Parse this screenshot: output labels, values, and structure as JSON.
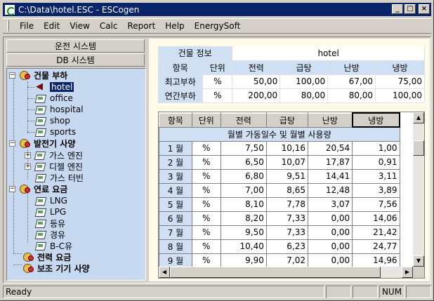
{
  "window": {
    "title": "C:\\Data\\hotel.ESC - ESCogen"
  },
  "menu": [
    "File",
    "Edit",
    "View",
    "Calc",
    "Report",
    "Help",
    "EnergySoft"
  ],
  "menu_underline": [
    "F",
    "E",
    "V",
    "",
    "",
    "H",
    ""
  ],
  "left": {
    "buttons": [
      "운전 시스템",
      "DB 시스템"
    ],
    "tree": {
      "root1": "건물 부하",
      "r1": [
        "hotel",
        "office",
        "hospital",
        "shop",
        "sports"
      ],
      "root2": "발전기 사양",
      "r2": [
        "가스 엔진",
        "디젤 엔진",
        "가스 터빈"
      ],
      "root3": "연료 요금",
      "r3": [
        "LNG",
        "LPG",
        "등유",
        "경유",
        "B-C유"
      ],
      "root4": "전력 요금",
      "root5": "보조 기기 사양"
    }
  },
  "info": {
    "title_label": "건물 정보",
    "title_value": "hotel",
    "headers": [
      "항목",
      "단위",
      "전력",
      "급탕",
      "난방",
      "냉방"
    ],
    "rows": [
      [
        "최고부하",
        "%",
        "50,00",
        "100,00",
        "67,00",
        "75,00"
      ],
      [
        "연간부하",
        "%",
        "200,00",
        "80,00",
        "80,00",
        "100,00"
      ]
    ]
  },
  "grid": {
    "headers": [
      "항목",
      "단위",
      "전력",
      "급탕",
      "난방",
      "냉방"
    ],
    "subheader": "월별 가동일수 및 월별 사용량",
    "rows": [
      [
        "1 월",
        "%",
        "7,50",
        "10,16",
        "20,54",
        "1,00"
      ],
      [
        "2 월",
        "%",
        "6,50",
        "10,07",
        "17,87",
        "0,91"
      ],
      [
        "3 월",
        "%",
        "6,80",
        "9,51",
        "14,41",
        "3,11"
      ],
      [
        "4 월",
        "%",
        "7,00",
        "8,65",
        "12,48",
        "3,89"
      ],
      [
        "5 월",
        "%",
        "8,10",
        "7,78",
        "3,07",
        "7,56"
      ],
      [
        "6 월",
        "%",
        "8,20",
        "7,33",
        "0,00",
        "14,06"
      ],
      [
        "7 월",
        "%",
        "9,50",
        "7,33",
        "0,00",
        "21,42"
      ],
      [
        "8 월",
        "%",
        "10,40",
        "6,23",
        "0,00",
        "24,77"
      ],
      [
        "9 월",
        "%",
        "9,90",
        "7,02",
        "0,00",
        "14,96"
      ]
    ]
  },
  "status": {
    "text": "Ready",
    "cells": [
      "",
      "",
      "NUM",
      ""
    ]
  },
  "colors": {
    "title_bar": "#0a246a",
    "tree_bg": "#c7d9f0",
    "header_bg": "#cfdff4",
    "pane_bg": "#fffbe8"
  }
}
